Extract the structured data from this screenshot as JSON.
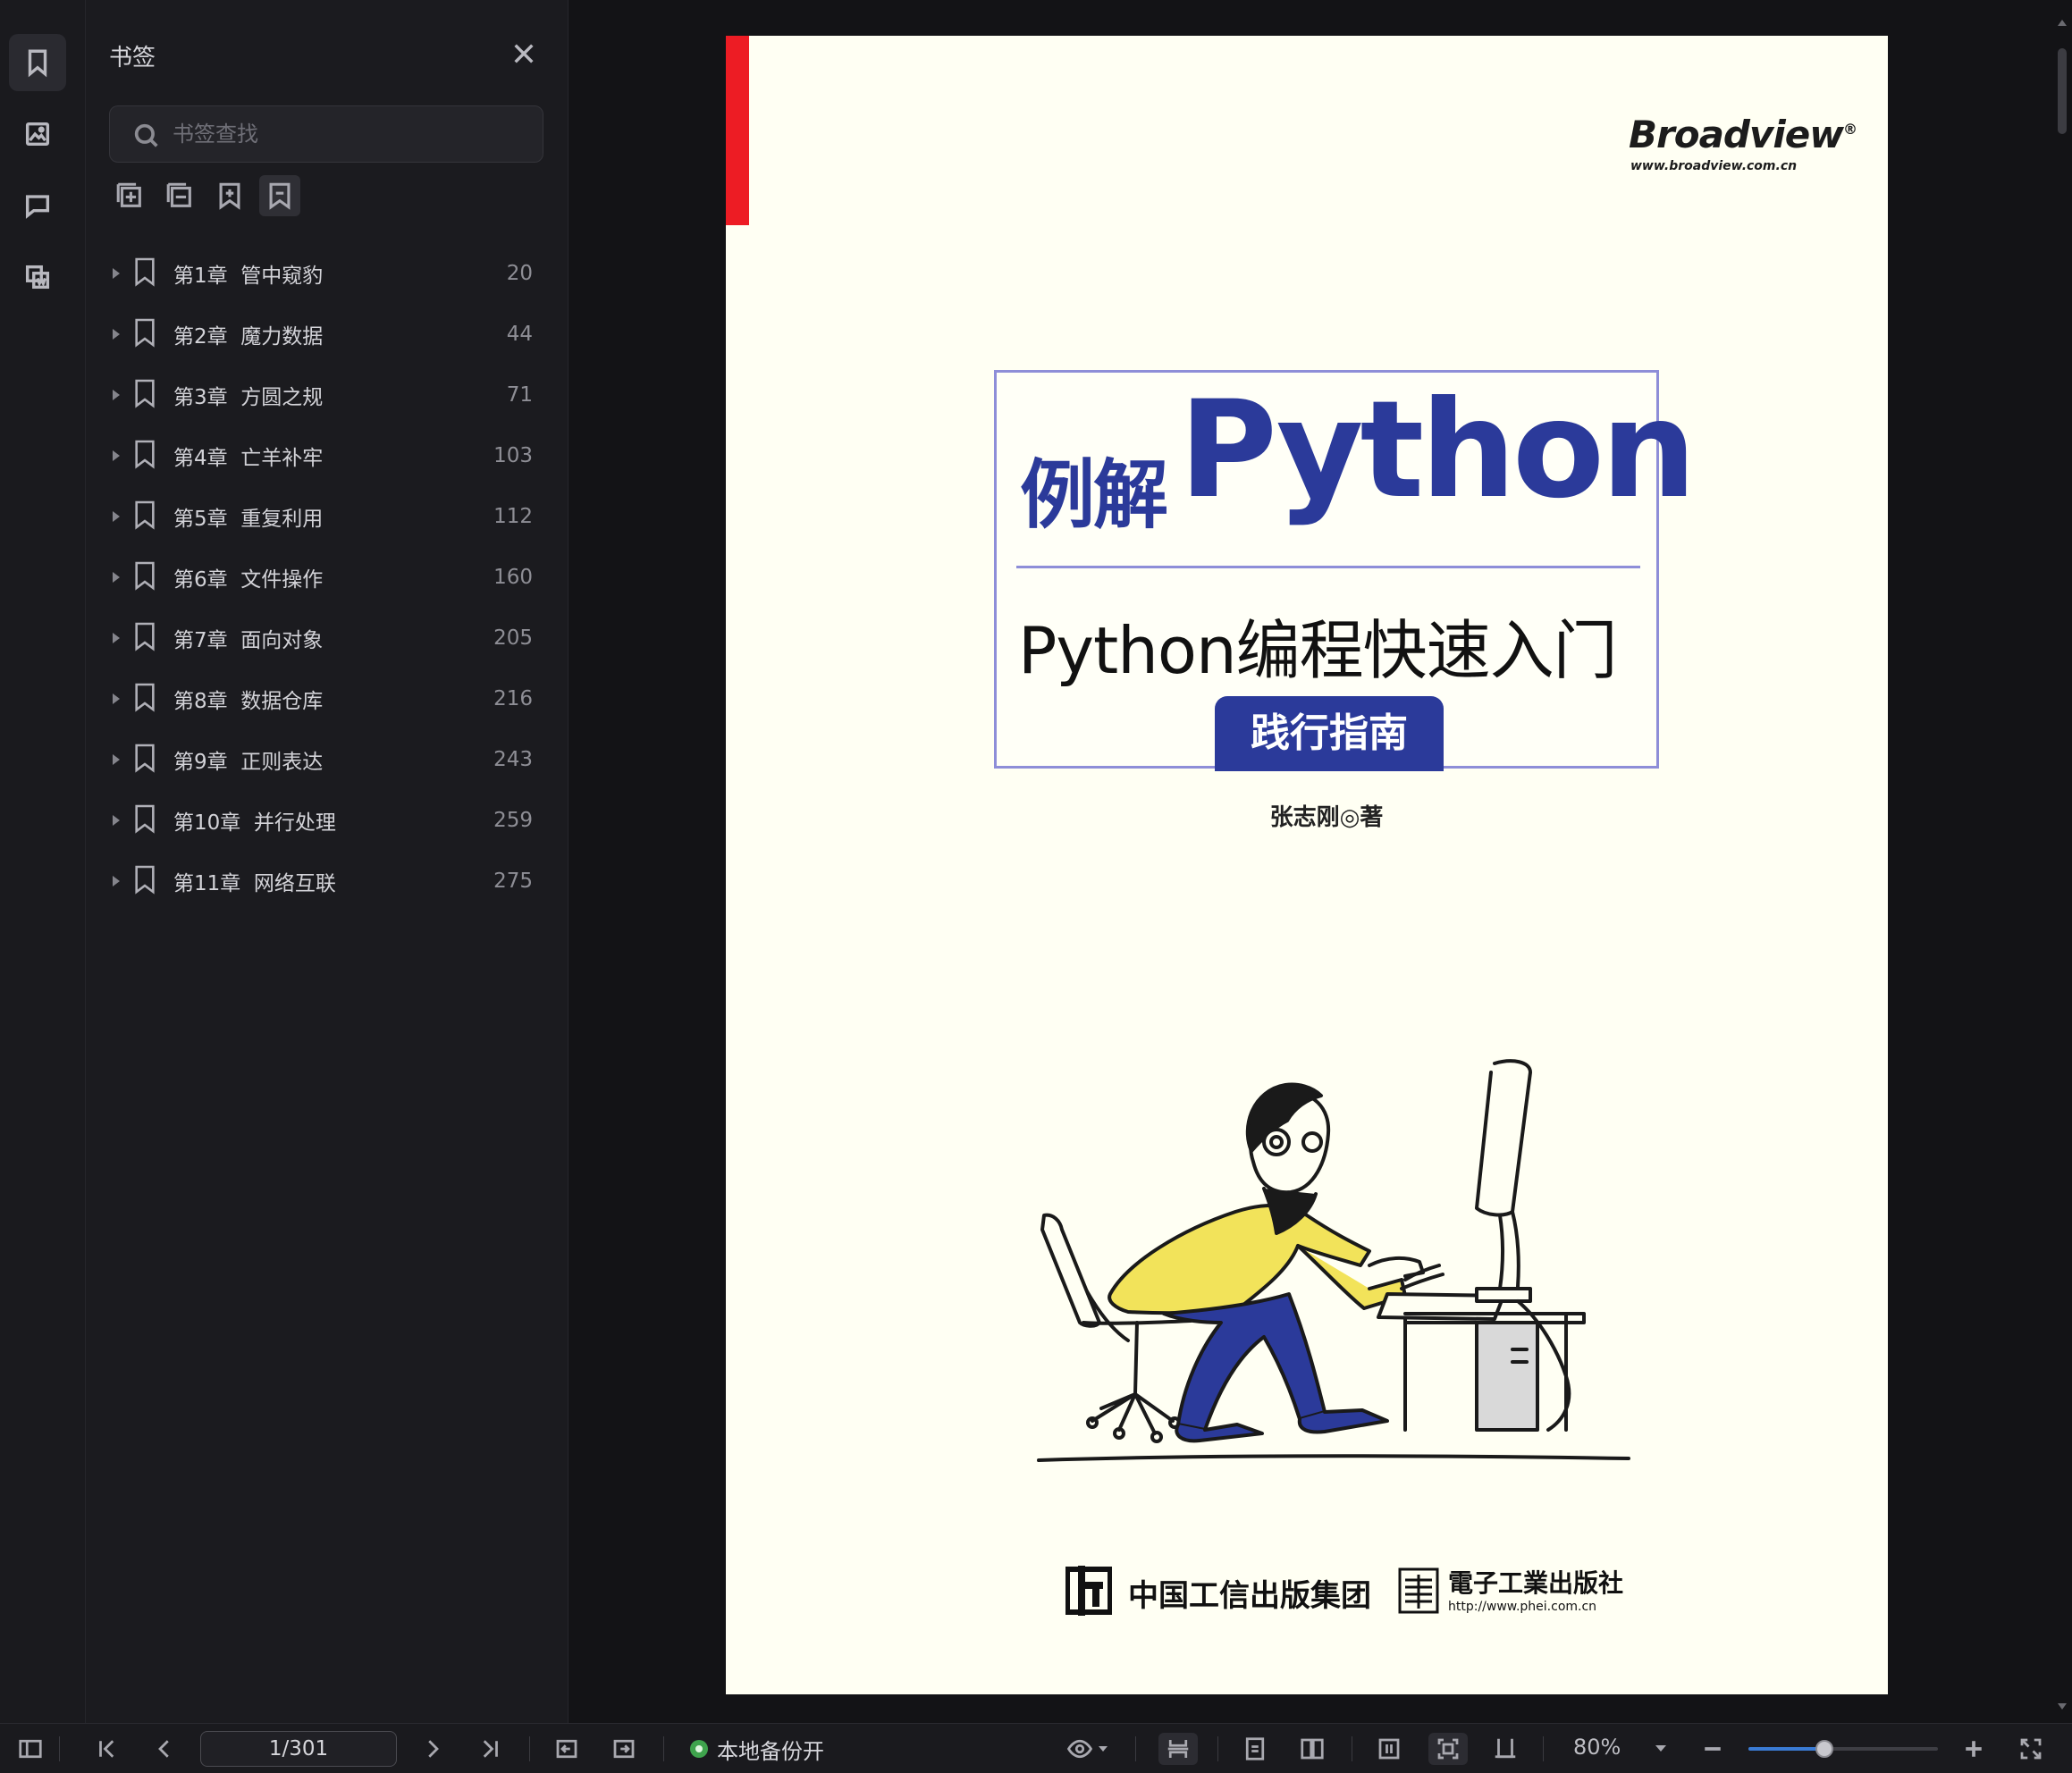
{
  "sidebar": {
    "panel_title": "书签",
    "search_placeholder": "书签查找",
    "bookmarks": [
      {
        "label": "第1章  管中窥豹",
        "page": "20"
      },
      {
        "label": "第2章  魔力数据",
        "page": "44"
      },
      {
        "label": "第3章  方圆之规",
        "page": "71"
      },
      {
        "label": "第4章  亡羊补牢",
        "page": "103"
      },
      {
        "label": "第5章  重复利用",
        "page": "112"
      },
      {
        "label": "第6章  文件操作",
        "page": "160"
      },
      {
        "label": "第7章  面向对象",
        "page": "205"
      },
      {
        "label": "第8章  数据仓库",
        "page": "216"
      },
      {
        "label": "第9章  正则表达",
        "page": "243"
      },
      {
        "label": "第10章  并行处理",
        "page": "259"
      },
      {
        "label": "第11章  网络互联",
        "page": "275"
      }
    ]
  },
  "cover": {
    "publisher_brand": "Broadview",
    "publisher_brand_mark": "®",
    "publisher_url": "www.broadview.com.cn",
    "title_cn": "例解",
    "title_en": "Python",
    "subtitle": "Python编程快速入门",
    "badge": "践行指南",
    "author": "张志刚◎著",
    "publisher_group": "中国工信出版集团",
    "publisher_house": "電子工業出版社",
    "publisher_house_url": "http://www.phei.com.cn"
  },
  "statusbar": {
    "page_indicator": "1/301",
    "backup_status": "本地备份开",
    "zoom": "80%",
    "zoom_slider_fraction": 0.4
  },
  "colors": {
    "accent": "#3a7bd5",
    "cover_blue": "#2b3a9a",
    "cover_red": "#ed1c24",
    "status_green": "#3fa34d"
  }
}
